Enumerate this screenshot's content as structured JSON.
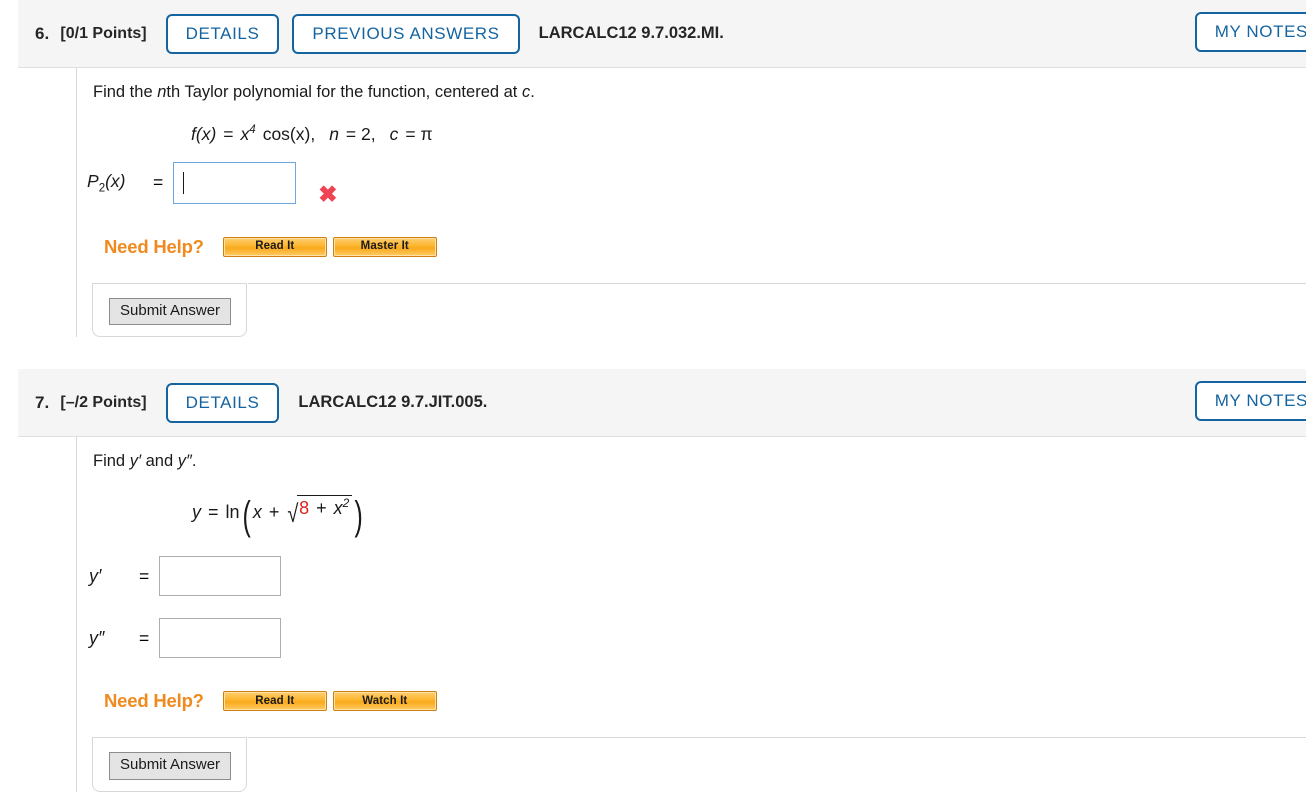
{
  "problems": [
    {
      "number": "6.",
      "points": "[0/1 Points]",
      "details_label": "DETAILS",
      "previous_answers_label": "PREVIOUS ANSWERS",
      "code": "LARCALC12 9.7.032.MI.",
      "my_notes_label": "MY NOTES",
      "prompt_part1": "Find the ",
      "prompt_italic": "n",
      "prompt_part2": "th Taylor polynomial for the function, centered at ",
      "prompt_italic2": "c",
      "prompt_part3": ".",
      "equation": {
        "fx": "f",
        "fx_arg": "(x)",
        "equals": "=",
        "base": "x",
        "exponent": "4",
        "trig": "cos(x),",
        "n_var": "n",
        "n_eq": "= 2,",
        "c_var": "c",
        "c_eq": "= π"
      },
      "answer_label": "P",
      "answer_sub": "2",
      "answer_label_rest": "(x)",
      "answer_equals": "=",
      "answer_value": "",
      "answer_status_icon": "red-x-incorrect-icon",
      "need_help_label": "Need Help?",
      "help_buttons": [
        "Read It",
        "Master It"
      ],
      "submit_label": "Submit Answer"
    },
    {
      "number": "7.",
      "points": "[–/2 Points]",
      "details_label": "DETAILS",
      "code": "LARCALC12 9.7.JIT.005.",
      "my_notes_label": "MY NOTES",
      "prompt_part1": "Find ",
      "prompt_italic": "y′",
      "prompt_part2": " and ",
      "prompt_italic2": "y″",
      "prompt_part3": ".",
      "equation": {
        "y": "y",
        "equals": "=",
        "ln": "ln",
        "x": "x",
        "plus": "+",
        "radicand_const": "8",
        "radicand_plus": "+",
        "radicand_var": "x",
        "radicand_exp": "2"
      },
      "rows": [
        {
          "label": "y′",
          "equals": "=",
          "value": ""
        },
        {
          "label": "y″",
          "equals": "=",
          "value": ""
        }
      ],
      "need_help_label": "Need Help?",
      "help_buttons": [
        "Read It",
        "Watch It"
      ],
      "submit_label": "Submit Answer"
    }
  ],
  "colors": {
    "accent_blue": "#1464a0",
    "header_bg": "#f5f5f5",
    "help_orange": "#f08a1e",
    "error_red": "#ee4455",
    "randomized_value_red": "#e02020"
  }
}
